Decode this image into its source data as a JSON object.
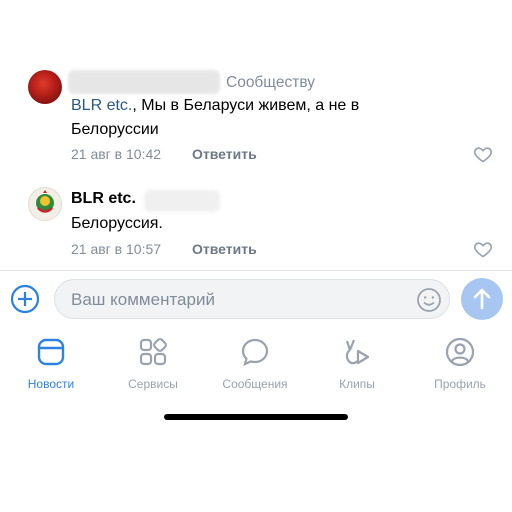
{
  "comments": [
    {
      "reply_to": "Сообществу",
      "mention": "BLR etc.",
      "text_after_mention": ", Мы в Беларуси живем, а не в Белоруссии",
      "time": "21 авг в 10:42",
      "reply_label": "Ответить"
    },
    {
      "author": "BLR etc.",
      "text": "Белоруссия.",
      "time": "21 авг в 10:57",
      "reply_label": "Ответить"
    }
  ],
  "composer": {
    "placeholder": "Ваш комментарий"
  },
  "tabbar": {
    "items": [
      {
        "label": "Новости",
        "icon": "news-icon",
        "active": true
      },
      {
        "label": "Сервисы",
        "icon": "services-icon",
        "active": false
      },
      {
        "label": "Сообщения",
        "icon": "messages-icon",
        "active": false
      },
      {
        "label": "Клипы",
        "icon": "clips-icon",
        "active": false
      },
      {
        "label": "Профиль",
        "icon": "profile-icon",
        "active": false
      }
    ]
  },
  "colors": {
    "accent": "#2d81e0",
    "link": "#2a5885",
    "secondary_text": "#818c99",
    "send_button": "#a7c7f2"
  }
}
